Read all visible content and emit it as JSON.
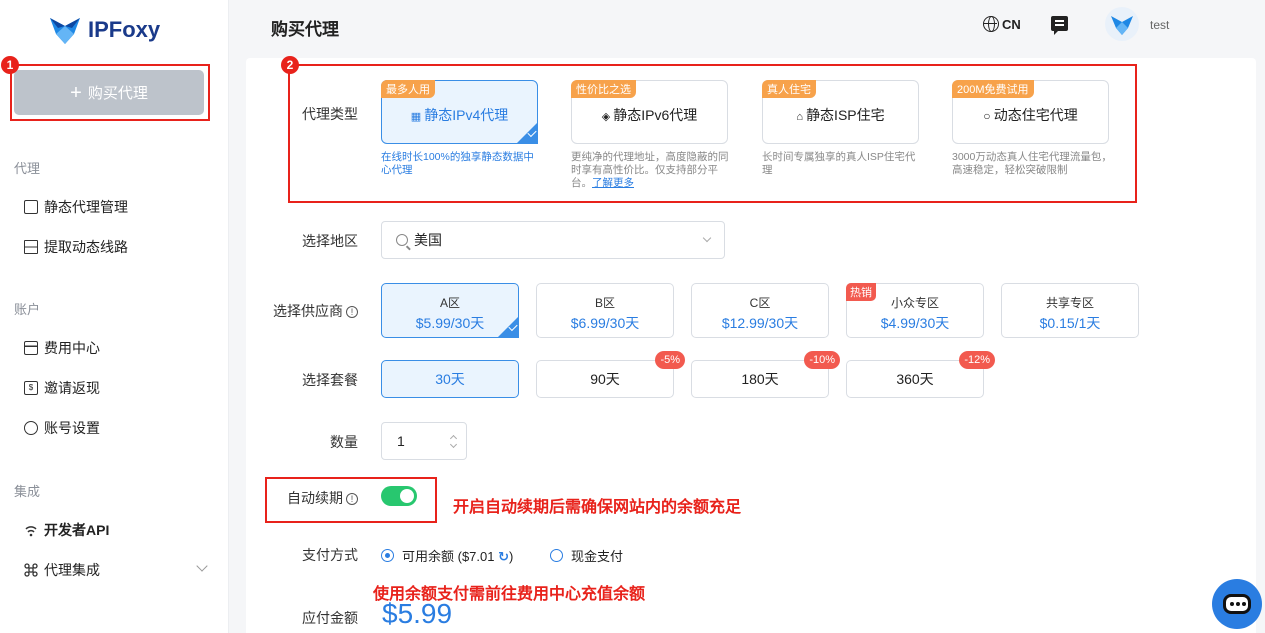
{
  "sidebar": {
    "logo_text": "IPFoxy",
    "buy_button": "购买代理",
    "sections": [
      {
        "title": "代理",
        "items": [
          "静态代理管理",
          "提取动态线路"
        ]
      },
      {
        "title": "账户",
        "items": [
          "费用中心",
          "邀请返现",
          "账号设置"
        ]
      },
      {
        "title": "集成",
        "items": [
          "开发者API",
          "代理集成"
        ]
      }
    ]
  },
  "header": {
    "title": "购买代理",
    "lang": "CN",
    "username": "test"
  },
  "form": {
    "proxy_type_label": "代理类型",
    "proxy_types": [
      {
        "tag": "最多人用",
        "label": "静态IPv4代理",
        "desc": "在线时长100%的独享静态数据中心代理",
        "selected": true
      },
      {
        "tag": "性价比之选",
        "label": "静态IPv6代理",
        "desc": "更纯净的代理地址，高度隐蔽的同时享有高性价比。仅支持部分平台。",
        "link": "了解更多"
      },
      {
        "tag": "真人住宅",
        "label": "静态ISP住宅",
        "desc": "长时间专属独享的真人ISP住宅代理"
      },
      {
        "tag": "200M免费试用",
        "label": "动态住宅代理",
        "desc": "3000万动态真人住宅代理流量包，高速稳定，轻松突破限制"
      }
    ],
    "region_label": "选择地区",
    "region_value": "美国",
    "provider_label": "选择供应商",
    "providers": [
      {
        "name": "A区",
        "price": "$5.99/30天",
        "selected": true
      },
      {
        "name": "B区",
        "price": "$6.99/30天"
      },
      {
        "name": "C区",
        "price": "$12.99/30天"
      },
      {
        "name": "小众专区",
        "price": "$4.99/30天",
        "hot": "热销"
      },
      {
        "name": "共享专区",
        "price": "$0.15/1天"
      }
    ],
    "plan_label": "选择套餐",
    "plans": [
      {
        "label": "30天",
        "selected": true
      },
      {
        "label": "90天",
        "discount": "-5%"
      },
      {
        "label": "180天",
        "discount": "-10%"
      },
      {
        "label": "360天",
        "discount": "-12%"
      }
    ],
    "qty_label": "数量",
    "qty_value": "1",
    "auto_renew_label": "自动续期",
    "auto_renew_on": true,
    "payment_label": "支付方式",
    "payment_balance": "可用余额 ($7.01",
    "payment_balance_close": ")",
    "payment_cash": "现金支付",
    "amount_label": "应付金额",
    "amount_value": "$5.99"
  },
  "annotations": {
    "num1": "1",
    "num2": "2",
    "note_auto_renew": "开启自动续期后需确保网站内的余额充足",
    "note_payment": "使用余额支付需前往费用中心充值余额"
  },
  "colors": {
    "accent": "#2a7de1",
    "annotation": "#e8221b",
    "toggle": "#28c76f",
    "tag": "#f7a24b",
    "hot": "#f25a4f"
  }
}
